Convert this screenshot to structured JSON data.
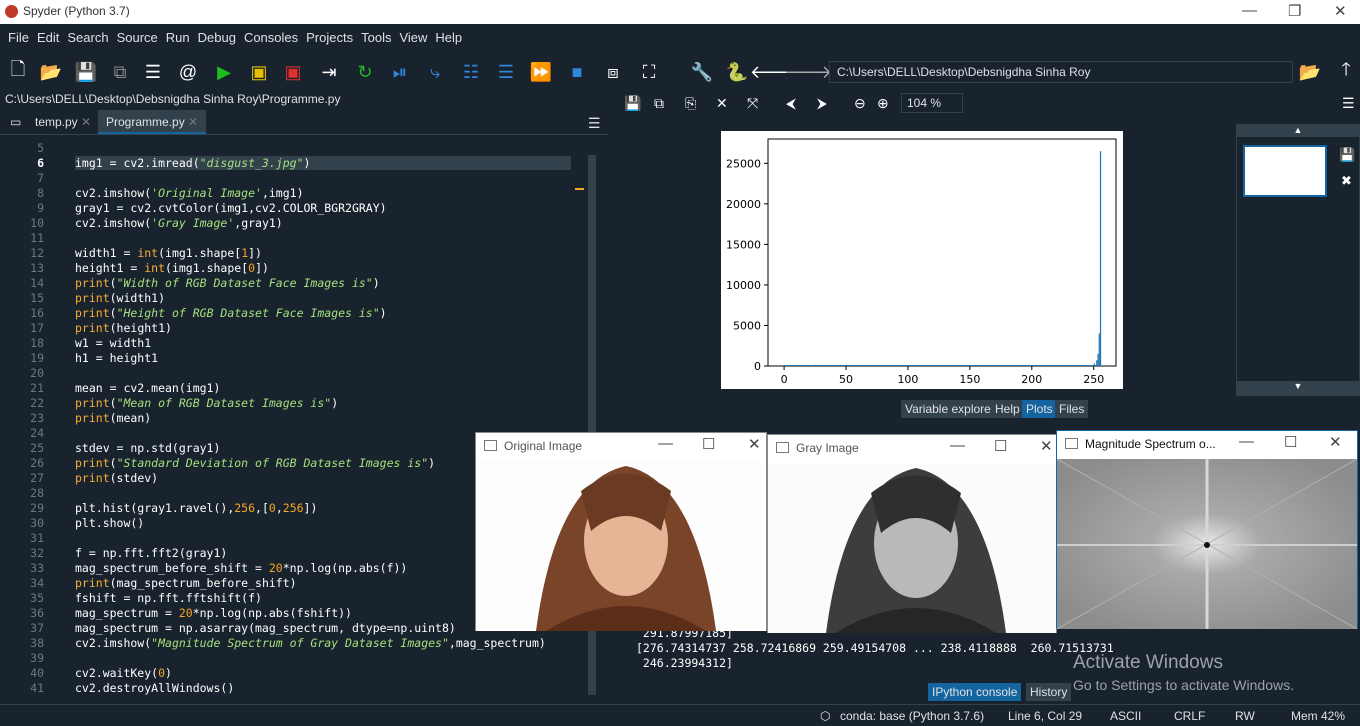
{
  "titlebar": {
    "title": "Spyder (Python 3.7)"
  },
  "menu": [
    "File",
    "Edit",
    "Search",
    "Source",
    "Run",
    "Debug",
    "Consoles",
    "Projects",
    "Tools",
    "View",
    "Help"
  ],
  "toolbar": {
    "path": "C:\\Users\\DELL\\Desktop\\Debsnigdha Sinha Roy"
  },
  "editor": {
    "filepath": "C:\\Users\\DELL\\Desktop\\Debsnigdha Sinha Roy\\Programme.py",
    "tabs": [
      "temp.py",
      "Programme.py"
    ],
    "lines": [
      {
        "n": "5",
        "c": ""
      },
      {
        "n": "6",
        "c": "img1 = cv2.imread(\"disgust_3.jpg\")"
      },
      {
        "n": "7",
        "c": ""
      },
      {
        "n": "8",
        "c": "cv2.imshow('Original Image',img1)"
      },
      {
        "n": "9",
        "c": "gray1 = cv2.cvtColor(img1,cv2.COLOR_BGR2GRAY)"
      },
      {
        "n": "10",
        "c": "cv2.imshow('Gray Image',gray1)"
      },
      {
        "n": "11",
        "c": ""
      },
      {
        "n": "12",
        "c": "width1 = int(img1.shape[1])"
      },
      {
        "n": "13",
        "c": "height1 = int(img1.shape[0])"
      },
      {
        "n": "14",
        "c": "print(\"Width of RGB Dataset Face Images is\")"
      },
      {
        "n": "15",
        "c": "print(width1)"
      },
      {
        "n": "16",
        "c": "print(\"Height of RGB Dataset Face Images is\")"
      },
      {
        "n": "17",
        "c": "print(height1)"
      },
      {
        "n": "18",
        "c": "w1 = width1"
      },
      {
        "n": "19",
        "c": "h1 = height1"
      },
      {
        "n": "20",
        "c": ""
      },
      {
        "n": "21",
        "c": "mean = cv2.mean(img1)"
      },
      {
        "n": "22",
        "c": "print(\"Mean of RGB Dataset Images is\")"
      },
      {
        "n": "23",
        "c": "print(mean)"
      },
      {
        "n": "24",
        "c": ""
      },
      {
        "n": "25",
        "c": "stdev = np.std(gray1)"
      },
      {
        "n": "26",
        "c": "print(\"Standard Deviation of RGB Dataset Images is\")"
      },
      {
        "n": "27",
        "c": "print(stdev)"
      },
      {
        "n": "28",
        "c": ""
      },
      {
        "n": "29",
        "c": "plt.hist(gray1.ravel(),256,[0,256])"
      },
      {
        "n": "30",
        "c": "plt.show()"
      },
      {
        "n": "31",
        "c": ""
      },
      {
        "n": "32",
        "c": "f = np.fft.fft2(gray1)"
      },
      {
        "n": "33",
        "c": "mag_spectrum_before_shift = 20*np.log(np.abs(f))"
      },
      {
        "n": "34",
        "c": "print(mag_spectrum_before_shift)"
      },
      {
        "n": "35",
        "c": "fshift = np.fft.fftshift(f)"
      },
      {
        "n": "36",
        "c": "mag_spectrum = 20*np.log(np.abs(fshift))"
      },
      {
        "n": "37",
        "c": "mag_spectrum = np.asarray(mag_spectrum, dtype=np.uint8)"
      },
      {
        "n": "38",
        "c": "cv2.imshow(\"Magnitude Spectrum of Gray Dataset Images\",mag_spectrum)"
      },
      {
        "n": "39",
        "c": ""
      },
      {
        "n": "40",
        "c": "cv2.waitKey(0)"
      },
      {
        "n": "41",
        "c": "cv2.destroyAllWindows()"
      }
    ]
  },
  "plots": {
    "zoom": "104 %",
    "tabs": [
      "Variable explorer",
      "Help",
      "Plots",
      "Files"
    ]
  },
  "chart_data": {
    "type": "bar",
    "title": "",
    "xlabel": "",
    "ylabel": "",
    "xlim": [
      -13,
      268
    ],
    "ylim": [
      0,
      28000
    ],
    "xticks": [
      "0",
      "50",
      "100",
      "150",
      "200",
      "250"
    ],
    "yticks": [
      "0",
      "5000",
      "10000",
      "15000",
      "20000",
      "25000"
    ],
    "series": [
      {
        "x": [
          0,
          20,
          25,
          30,
          45,
          50,
          55,
          230,
          250,
          252,
          253,
          254,
          255
        ],
        "values": [
          60,
          120,
          150,
          130,
          140,
          160,
          120,
          80,
          300,
          700,
          1500,
          4000,
          26500
        ]
      }
    ],
    "color": "#1f77b4"
  },
  "console": {
    "lines": [
      " 291.87997185]",
      "[276.74314737 258.72416869 259.49154708 ... 238.4118888  260.71513731",
      " 246.23994312]"
    ],
    "tabs": [
      "IPython console",
      "History"
    ],
    "watermark1": "Activate Windows",
    "watermark2": "Go to Settings to activate Windows."
  },
  "windows": {
    "original": "Original Image",
    "gray": "Gray Image",
    "magnitude": "Magnitude Spectrum o..."
  },
  "status": {
    "env": "conda: base (Python 3.7.6)",
    "pos": "Line 6, Col 29",
    "enc": "ASCII",
    "eol": "CRLF",
    "rw": "RW",
    "mem": "Mem 42%"
  }
}
